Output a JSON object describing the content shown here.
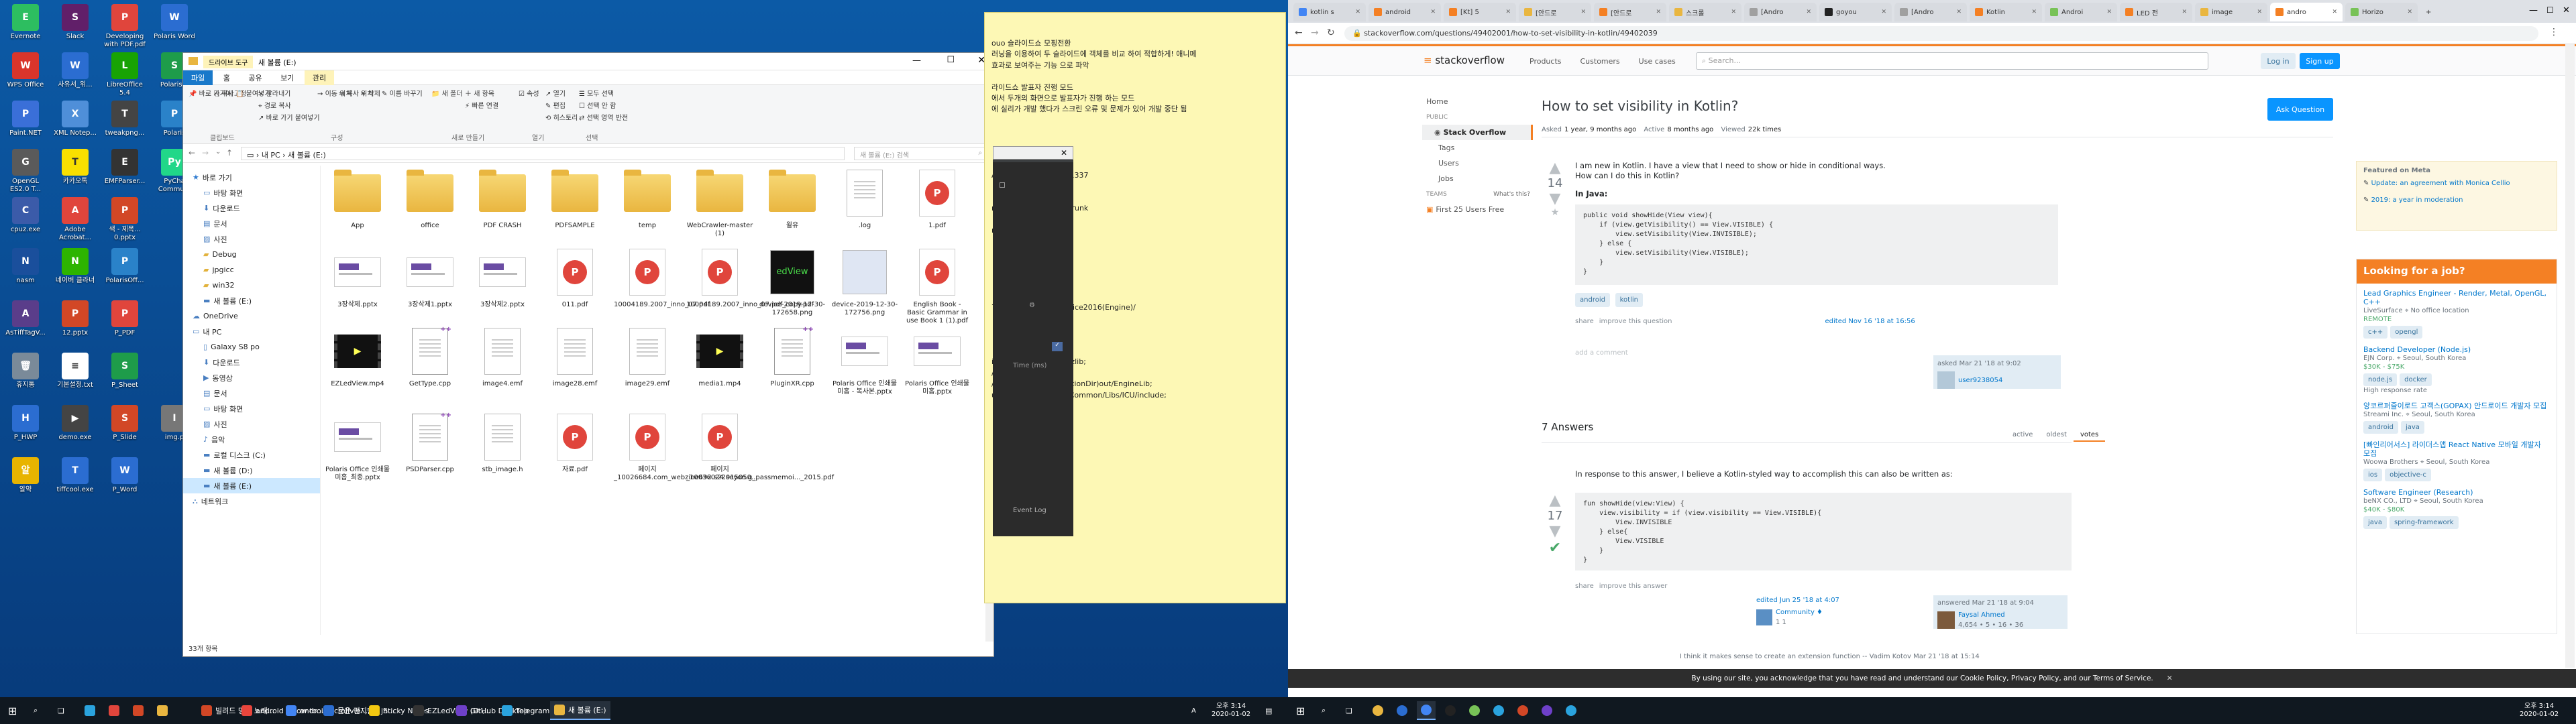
{
  "desktop": {
    "icons": [
      {
        "label": "Evernote",
        "color": "#2dbe60",
        "glyph": "E"
      },
      {
        "label": "Slack",
        "color": "#611f69",
        "glyph": "S"
      },
      {
        "label": "Developing with PDF.pdf",
        "color": "#e0453c",
        "glyph": "P"
      },
      {
        "label": "Polaris Word",
        "color": "#2b6dd1",
        "glyph": "W"
      },
      {
        "label": "WPS Office",
        "color": "#d9352b",
        "glyph": "W"
      },
      {
        "label": "사유서_위...",
        "color": "#2b6dd1",
        "glyph": "W"
      },
      {
        "label": "LibreOffice 5.4",
        "color": "#18a303",
        "glyph": "L"
      },
      {
        "label": "Polaris S",
        "color": "#1e9c4a",
        "glyph": "S"
      },
      {
        "label": "Paint.NET",
        "color": "#3a6fd8",
        "glyph": "P"
      },
      {
        "label": "XML Notep...",
        "color": "#4f8fd9",
        "glyph": "X"
      },
      {
        "label": "tweakpng...",
        "color": "#444",
        "glyph": "T"
      },
      {
        "label": "Polaris",
        "color": "#2a82c9",
        "glyph": "P"
      },
      {
        "label": "OpenGL ES2.0 T...",
        "color": "#5a5a5a",
        "glyph": "G"
      },
      {
        "label": "카카오톡",
        "color": "#f9e000",
        "glyph": "T"
      },
      {
        "label": "EMFParser...",
        "color": "#333",
        "glyph": "E"
      },
      {
        "label": "PyCha Commu...",
        "color": "#21d789",
        "glyph": "Py"
      },
      {
        "label": "cpuz.exe",
        "color": "#3b5ba9",
        "glyph": "C"
      },
      {
        "label": "Adobe Acrobat...",
        "color": "#e0453c",
        "glyph": "A"
      },
      {
        "label": "색 - 제목... 0.pptx",
        "color": "#d24726",
        "glyph": "P"
      },
      {
        "label": "nasm",
        "color": "#1a4f9c",
        "glyph": "N"
      },
      {
        "label": "네이버 클라너",
        "color": "#2db400",
        "glyph": "N"
      },
      {
        "label": "PolarisOff...",
        "color": "#2a82c9",
        "glyph": "P"
      },
      {
        "label": "AsTiffTagV...",
        "color": "#5a3d8a",
        "glyph": "A"
      },
      {
        "label": "12.pptx",
        "color": "#d24726",
        "glyph": "P"
      },
      {
        "label": "P_PDF",
        "color": "#e0453c",
        "glyph": "P"
      },
      {
        "label": "휴지통",
        "color": "#7a8a99",
        "glyph": "🗑"
      },
      {
        "label": "기본설정.txt",
        "color": "#ffffff",
        "glyph": "≡"
      },
      {
        "label": "P_Sheet",
        "color": "#1e9c4a",
        "glyph": "S"
      },
      {
        "label": "P_HWP",
        "color": "#2b6dd1",
        "glyph": "H"
      },
      {
        "label": "demo.exe",
        "color": "#444",
        "glyph": "▶"
      },
      {
        "label": "P_Slide",
        "color": "#d24726",
        "glyph": "S"
      },
      {
        "label": "img.p",
        "color": "#777",
        "glyph": "I"
      },
      {
        "label": "알약",
        "color": "#e8b400",
        "glyph": "알"
      },
      {
        "label": "tiffcool.exe",
        "color": "#2b6dd1",
        "glyph": "T"
      },
      {
        "label": "P_Word",
        "color": "#2b6dd1",
        "glyph": "W"
      }
    ]
  },
  "taskbar_left": {
    "items": [
      "빌려드 명곡 노래...",
      "android - How to...",
      "android scrollvie...",
      "문은 편지함 - jh...",
      "Sticky Notes",
      "EZLedView (D:\\...",
      "GitHub Desktop",
      "Telegram",
      "새 볼륨 (E:)"
    ],
    "clock": "오후 3:14",
    "date": "2020-01-02",
    "lang": "A"
  },
  "explorer": {
    "title": "새 볼륨 (E:)",
    "context_tab": "드라이브 도구",
    "context_sub": "관리",
    "ribbon_tabs": [
      "파일",
      "홈",
      "공유",
      "보기"
    ],
    "ribbon_groups": [
      "클립보드",
      "구성",
      "새로 만들기",
      "열기",
      "선택"
    ],
    "ribbon_buttons": [
      "바로 가기에 고정",
      "복사",
      "붙여넣기",
      "잘라내기",
      "경로 복사",
      "바로 가기 붙여넣기",
      "이동 위치",
      "복사 위치",
      "삭제",
      "이름 바꾸기",
      "새 폴더",
      "새 항목",
      "빠른 연결",
      "속성",
      "열기",
      "편집",
      "히스토리",
      "모두 선택",
      "선택 안 함",
      "선택 영역 반전"
    ],
    "path": [
      "내 PC",
      "새 볼륨 (E:)"
    ],
    "search_placeholder": "새 볼륨 (E:) 검색",
    "tree": [
      {
        "label": "바로 가기",
        "indent": 0,
        "icon": "star-icon"
      },
      {
        "label": "바탕 화면",
        "indent": 1,
        "icon": "desktop-icon"
      },
      {
        "label": "다운로드",
        "indent": 1,
        "icon": "download-icon"
      },
      {
        "label": "문서",
        "indent": 1,
        "icon": "doc-icon"
      },
      {
        "label": "사진",
        "indent": 1,
        "icon": "picture-icon"
      },
      {
        "label": "Debug",
        "indent": 1,
        "icon": "folder-icon"
      },
      {
        "label": "jpgicc",
        "indent": 1,
        "icon": "folder-icon"
      },
      {
        "label": "win32",
        "indent": 1,
        "icon": "folder-icon"
      },
      {
        "label": "새 볼륨 (E:)",
        "indent": 1,
        "icon": "drive-icon"
      },
      {
        "label": "OneDrive",
        "indent": 0,
        "icon": "cloud-icon"
      },
      {
        "label": "내 PC",
        "indent": 0,
        "icon": "pc-icon"
      },
      {
        "label": "Galaxy S8 po",
        "indent": 1,
        "icon": "phone-icon"
      },
      {
        "label": "다운로드",
        "indent": 1,
        "icon": "download-icon"
      },
      {
        "label": "동영상",
        "indent": 1,
        "icon": "video-icon"
      },
      {
        "label": "문서",
        "indent": 1,
        "icon": "doc-icon"
      },
      {
        "label": "바탕 화면",
        "indent": 1,
        "icon": "desktop-icon"
      },
      {
        "label": "사진",
        "indent": 1,
        "icon": "picture-icon"
      },
      {
        "label": "음악",
        "indent": 1,
        "icon": "music-icon"
      },
      {
        "label": "로컬 디스크 (C:)",
        "indent": 1,
        "icon": "drive-icon"
      },
      {
        "label": "새 볼륨 (D:)",
        "indent": 1,
        "icon": "drive-icon"
      },
      {
        "label": "새 볼륨 (E:)",
        "indent": 1,
        "icon": "drive-icon",
        "selected": true
      },
      {
        "label": "네트워크",
        "indent": 0,
        "icon": "network-icon"
      }
    ],
    "files": [
      {
        "name": "App",
        "kind": "folder"
      },
      {
        "name": "office",
        "kind": "folder"
      },
      {
        "name": "PDF CRASH",
        "kind": "folder"
      },
      {
        "name": "PDFSAMPLE",
        "kind": "folder"
      },
      {
        "name": "temp",
        "kind": "folder"
      },
      {
        "name": "WebCrawler-master (1)",
        "kind": "folder"
      },
      {
        "name": "월유",
        "kind": "folder"
      },
      {
        "name": ".log",
        "kind": "doc"
      },
      {
        "name": "1.pdf",
        "kind": "pdf"
      },
      {
        "name": "3장삭제.pptx",
        "kind": "ppt"
      },
      {
        "name": "3장삭제1.pptx",
        "kind": "ppt"
      },
      {
        "name": "3장삭제2.pptx",
        "kind": "ppt"
      },
      {
        "name": "011.pdf",
        "kind": "pdf"
      },
      {
        "name": "10004189.2007_inno_07.pdf",
        "kind": "pdf"
      },
      {
        "name": "10004189.2007_inno_07.pdf_copy.pdf",
        "kind": "pdf"
      },
      {
        "name": "device-2019-12-30-172658.png",
        "kind": "img"
      },
      {
        "name": "device-2019-12-30-172756.png",
        "kind": "img"
      },
      {
        "name": "English Book - Basic Grammar in use Book 1 (1).pdf",
        "kind": "pdf"
      },
      {
        "name": "EZLedView.mp4",
        "kind": "video"
      },
      {
        "name": "GetType.cpp",
        "kind": "cpp"
      },
      {
        "name": "image4.emf",
        "kind": "doc"
      },
      {
        "name": "image28.emf",
        "kind": "doc"
      },
      {
        "name": "image29.emf",
        "kind": "doc"
      },
      {
        "name": "media1.mp4",
        "kind": "video"
      },
      {
        "name": "PluginXR.cpp",
        "kind": "cpp"
      },
      {
        "name": "Polaris Office 인쇄물 미흡 - 복사본.pptx",
        "kind": "ppt"
      },
      {
        "name": "Polaris Office 인쇄물 미흡.pptx",
        "kind": "ppt"
      },
      {
        "name": "Polaris Office 인쇄물 미흡_최종.pptx",
        "kind": "ppt"
      },
      {
        "name": "PSDParser.cpp",
        "kind": "cpp"
      },
      {
        "name": "stb_image.h",
        "kind": "doc"
      },
      {
        "name": "자료.pdf",
        "kind": "pdf"
      },
      {
        "name": "페이지_10026684.com_webzine692.s22015050...",
        "kind": "pdf"
      },
      {
        "name": "페이지_10036024.seyon.g_passmemoi..._2015.pdf",
        "kind": "pdf"
      }
    ],
    "status": "33개 항목"
  },
  "sticky": {
    "lines": [
      "ouo 슬라이드쇼 모핑전환",
      "러닝을 이용하여 두 슬라이드에 객체를 비교 하여 적합하게! 애니메",
      "효과로 보여주는 기능 으로 파악",
      "",
      "라이드쇼 발표자 진행 모드",
      "에서 두개의 화면으로 발표자가 진행 하는 모드",
      "에 실리가 개발 했다가 스크린 오류 및 문제가 있어 개발 중단 됨",
      "",
      "",
      "",
      "",
      "",
      "AB3BC_20180217-231337",
      "",
      "",
      "rt/svn/PolarisOffice7/Trunk",
      "",
      "r if(condition_holds)",
      "",
      "",
      "",
      "",
      "",
      "",
      "770.33158/Source/Office2016(Engine)/",
      "",
      "",
      "",
      "",
      "in32/OfficeConverter/zlib;",
      "/include;",
      "/include/win32;$(SolutionDir)out/EngineLib;",
      "utionDir)../../sources/Common/Libs/ICU/include;"
    ],
    "bottom_label": "Event Log",
    "side_label": "Time (ms)"
  },
  "browser": {
    "tabs": [
      "kotlin s",
      "android",
      "[Kt] 5",
      "[안드로",
      "[안드로",
      "스크롤",
      "[Andro",
      "goyou",
      "[Andro",
      "Kotlin",
      "Androi",
      "LED 전",
      "image",
      "andro",
      "Horizo"
    ],
    "url": "stackoverflow.com/questions/49402001/how-to-set-visibility-in-kotlin/49402039",
    "so": {
      "logo": "stackoverflow",
      "nav": [
        "Products",
        "Customers",
        "Use cases"
      ],
      "search_placeholder": "Search...",
      "login": "Log in",
      "signup": "Sign up",
      "sidebar": [
        "Home",
        "PUBLIC",
        "Stack Overflow",
        "Tags",
        "Users",
        "Jobs",
        "TEAMS",
        "What's this?",
        "First 25 Users Free"
      ],
      "title": "How to set visibility in Kotlin?",
      "ask": "Ask Question",
      "meta": {
        "asked_l": "Asked",
        "asked": "1 year, 9 months ago",
        "active_l": "Active",
        "active": "8 months ago",
        "viewed_l": "Viewed",
        "viewed": "22k times"
      },
      "q_votes": "14",
      "q_text1": "I am new in Kotlin. I have a view that I need to show or hide in conditional ways.",
      "q_text2": "How can I do this in Kotlin?",
      "q_sub": "In Java:",
      "q_code": "public void showHide(View view){\n    if (view.getVisibility() == View.VISIBLE) {\n        view.setVisibility(View.INVISIBLE);\n    } else {\n        view.setVisibility(View.VISIBLE);\n    }\n}",
      "q_tags": [
        "android",
        "kotlin"
      ],
      "share": "share",
      "improve": "improve this question",
      "edited": "edited Nov 16 '18 at 16:56",
      "asked_card": "asked Mar 21 '18 at 9:02",
      "asked_user": "user9238054",
      "add_comment": "add a comment",
      "answers_count": "7 Answers",
      "sort": [
        "active",
        "oldest",
        "votes"
      ],
      "a_votes": "17",
      "a_text": "In response to this answer, I believe a Kotlin-styled way to accomplish this can also be written as:",
      "a_code": "fun showHide(view:View) {\n    view.visibility = if (view.visibility == View.VISIBLE){\n        View.INVISIBLE\n    } else{\n        View.VISIBLE\n    }\n}",
      "a_share": "share",
      "a_improve": "improve this answer",
      "a_edited": "edited Jun 25 '18 at 4:07",
      "a_community": "Community ♦",
      "a_comm_rep": "1  1",
      "a_answered": "answered Mar 21 '18 at 9:04",
      "a_user": "Faysal Ahmed",
      "a_rep": "4,654 • 5 • 16 • 36",
      "comment_line": "I think it makes sense to create an extension function -- Vadim Kotov Mar 21 '18 at 15:14",
      "cookie": "By using our site, you acknowledge that you have read and understand our Cookie Policy, Privacy Policy, and our Terms of Service.",
      "meta_head": "Featured on Meta",
      "meta_items": [
        "Update: an agreement with Monica Cellio",
        "2019: a year in moderation"
      ],
      "jobs_head": "Looking for a job?",
      "jobs": [
        {
          "title": "Lead Graphics Engineer - Render, Metal, OpenGL, C++",
          "company": "LiveSurface",
          "loc": "No office location",
          "extra": "REMOTE",
          "tags": [
            "c++",
            "opengl"
          ]
        },
        {
          "title": "Backend Developer (Node.js)",
          "company": "EJN Corp.",
          "loc": "Seoul, South Korea",
          "extra": "$30K - $75K",
          "tags": [
            "node.js",
            "docker"
          ],
          "note": "High response rate"
        },
        {
          "title": "앙코르퍼즐이로드 고객스(GOPAX) 안드로이드 개발자 모집",
          "company": "Streami Inc.",
          "loc": "Seoul, South Korea",
          "extra": "",
          "tags": [
            "android",
            "java"
          ]
        },
        {
          "title": "[빠인리어서스] 라이더스앱 React Native 모바일 개발자 모집",
          "company": "Woowa Brothers",
          "loc": "Seoul, South Korea",
          "extra": "",
          "tags": [
            "ios",
            "objective-c"
          ]
        },
        {
          "title": "Software Engineer (Research)",
          "company": "beNX CO., LTD",
          "loc": "Seoul, South Korea",
          "extra": "$40K - $80K",
          "tags": [
            "java",
            "spring-framework"
          ]
        }
      ]
    }
  },
  "taskbar_right": {
    "clock": "오후 3:14",
    "date": "2020-01-02"
  },
  "colors": {
    "so_orange": "#f48024",
    "so_blue": "#0a95ff",
    "job_header": "#f48024"
  }
}
